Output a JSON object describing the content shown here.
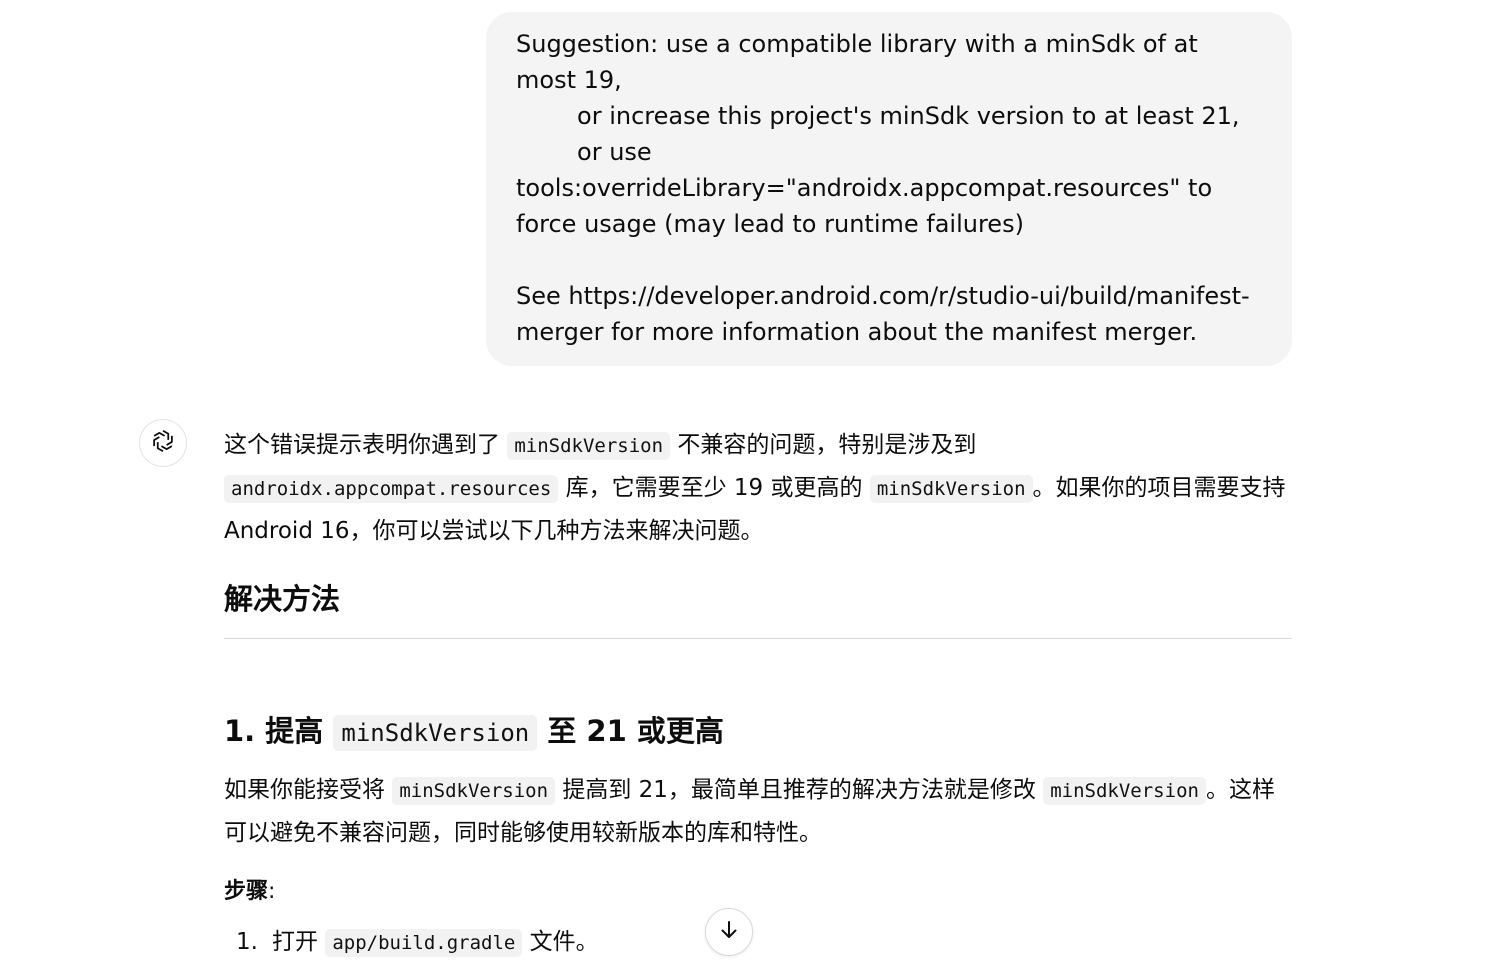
{
  "user_message": {
    "line1": "Suggestion: use a compatible library with a minSdk of at most 19,",
    "line2": "        or increase this project's minSdk version to at least 21,",
    "line3": "        or use tools:overrideLibrary=\"androidx.appcompat.resources\" to force usage (may lead to runtime failures)",
    "line4": "See https://developer.android.com/r/studio-ui/build/manifest-merger for more information about the manifest merger."
  },
  "assistant": {
    "avatar_icon": "openai-logo-icon",
    "intro": {
      "t1": "这个错误提示表明你遇到了 ",
      "c1": "minSdkVersion",
      "t2": " 不兼容的问题，特别是涉及到 ",
      "c2": "androidx.appcompat.resources",
      "t3": " 库，它需要至少 19 或更高的 ",
      "c3": "minSdkVersion",
      "t4": "。如果你的项目需要支持 Android 16，你可以尝试以下几种方法来解决问题。"
    },
    "section_title": "解决方法",
    "step1": {
      "prefix": "1. 提高 ",
      "code": "minSdkVersion",
      "suffix": " 至 21 或更高",
      "para": {
        "t1": "如果你能接受将 ",
        "c1": "minSdkVersion",
        "t2": " 提高到 21，最简单且推荐的解决方法就是修改 ",
        "c2": "minSdkVersion",
        "t3": "。这样可以避免不兼容问题，同时能够使用较新版本的库和特性。"
      },
      "steps_label": "步骤",
      "steps_colon": ":",
      "list": [
        {
          "num": "1.",
          "t1": "打开 ",
          "code": "app/build.gradle",
          "t2": " 文件。"
        }
      ]
    }
  },
  "scroll_button_icon": "arrow-down-icon"
}
